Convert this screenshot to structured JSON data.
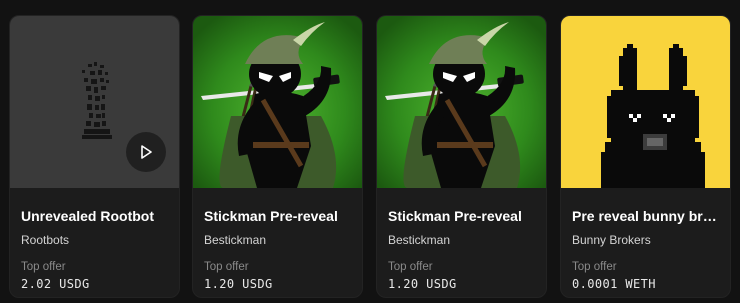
{
  "cards": [
    {
      "title": "Unrevealed Rootbot",
      "collection": "Rootbots",
      "offer_label": "Top offer",
      "offer_value": "2.02 USDG",
      "thumbnail_icon": "rootbot-placeholder",
      "has_play_button": true
    },
    {
      "title": "Stickman Pre-reveal",
      "collection": "Bestickman",
      "offer_label": "Top offer",
      "offer_value": "1.20 USDG",
      "thumbnail_icon": "stickman-archer-art"
    },
    {
      "title": "Stickman Pre-reveal",
      "collection": "Bestickman",
      "offer_label": "Top offer",
      "offer_value": "1.20 USDG",
      "thumbnail_icon": "stickman-archer-art"
    },
    {
      "title": "Pre reveal bunny brokers",
      "collection": "Bunny Brokers",
      "offer_label": "Top offer",
      "offer_value": "0.0001 WETH",
      "thumbnail_icon": "pixel-bunny-art"
    }
  ],
  "colors": {
    "page_bg": "#121212",
    "card_bg": "#1c1c1c",
    "stickman_bg": "#2f8a1c",
    "bunny_bg": "#f9d43c"
  }
}
